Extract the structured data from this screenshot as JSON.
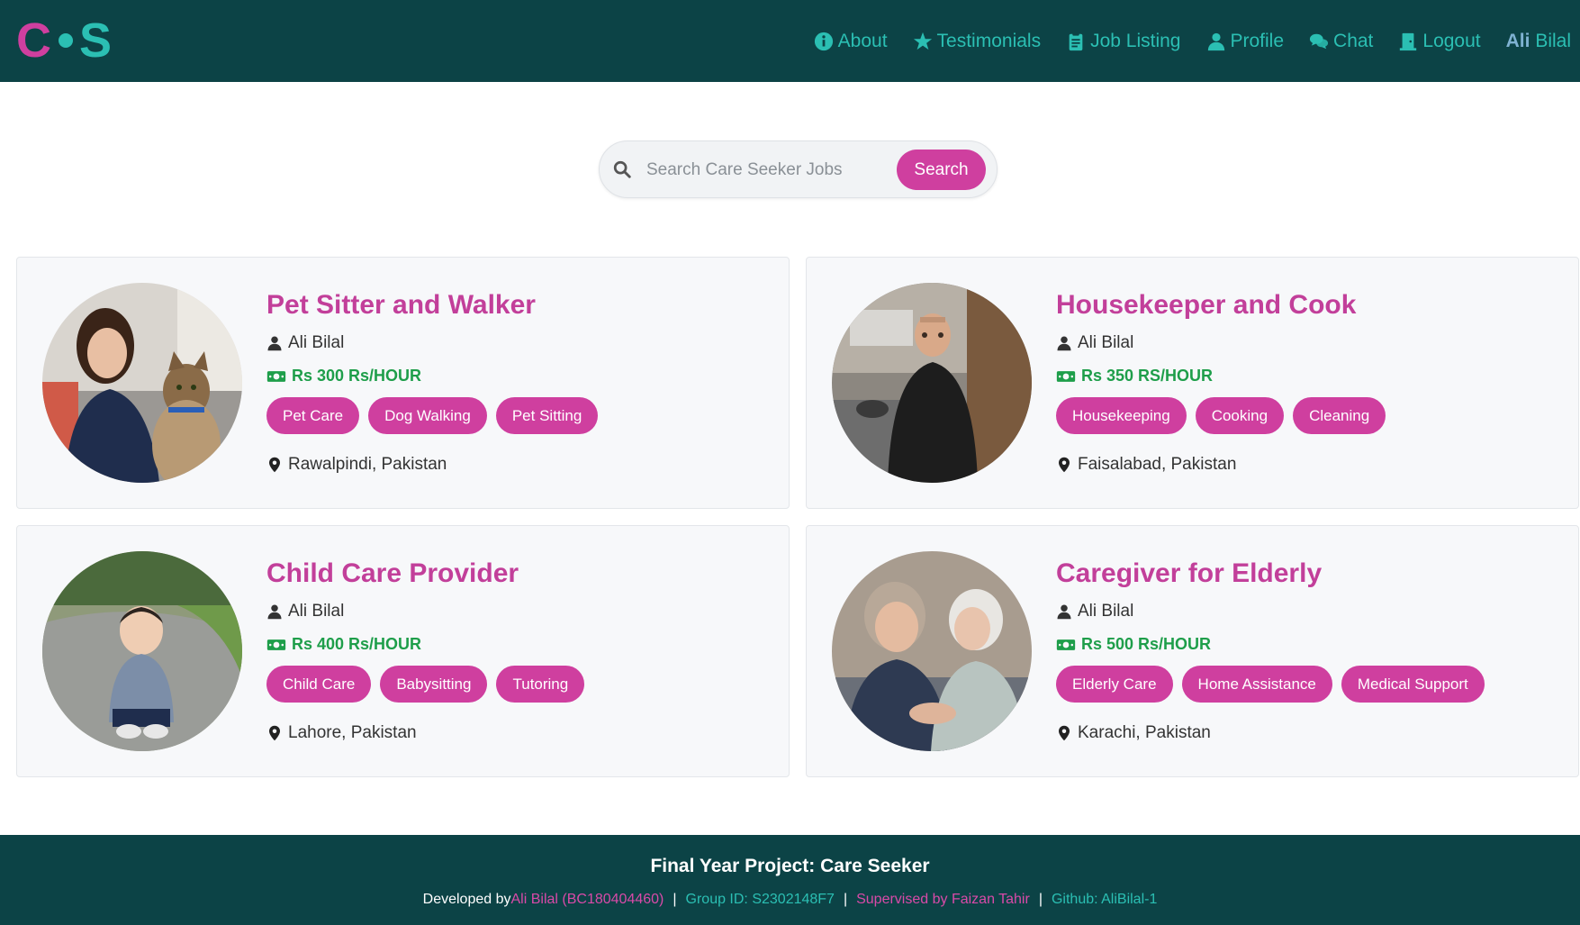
{
  "brand": {
    "logo_left": "C",
    "logo_right": "S"
  },
  "nav": {
    "items": [
      {
        "label": "About",
        "icon": "info-circle-icon"
      },
      {
        "label": "Testimonials",
        "icon": "star-icon"
      },
      {
        "label": "Job Listing",
        "icon": "clipboard-icon"
      },
      {
        "label": "Profile",
        "icon": "user-icon"
      },
      {
        "label": "Chat",
        "icon": "chat-bubbles-icon"
      },
      {
        "label": "Logout",
        "icon": "door-icon"
      }
    ],
    "user_first": "Ali",
    "user_last": "Bilal"
  },
  "search": {
    "placeholder": "Search Care Seeker Jobs",
    "value": "",
    "button_label": "Search"
  },
  "jobs": [
    {
      "title": "Pet Sitter and Walker",
      "owner": "Ali Bilal",
      "rate": "Rs 300 Rs/HOUR",
      "tags": [
        "Pet Care",
        "Dog Walking",
        "Pet Sitting"
      ],
      "location": "Rawalpindi, Pakistan"
    },
    {
      "title": "Housekeeper and Cook",
      "owner": "Ali Bilal",
      "rate": "Rs 350 RS/HOUR",
      "tags": [
        "Housekeeping",
        "Cooking",
        "Cleaning"
      ],
      "location": "Faisalabad, Pakistan"
    },
    {
      "title": "Child Care Provider",
      "owner": "Ali Bilal",
      "rate": "Rs 400 Rs/HOUR",
      "tags": [
        "Child Care",
        "Babysitting",
        "Tutoring"
      ],
      "location": "Lahore, Pakistan"
    },
    {
      "title": "Caregiver for Elderly",
      "owner": "Ali Bilal",
      "rate": "Rs 500 Rs/HOUR",
      "tags": [
        "Elderly Care",
        "Home Assistance",
        "Medical Support"
      ],
      "location": "Karachi, Pakistan"
    }
  ],
  "footer": {
    "title": "Final Year Project: Care Seeker",
    "developed_prefix": "Developed by ",
    "developer": "Ali Bilal (BC180404460)",
    "group": "Group ID: S2302148F7",
    "supervisor": "Supervised by Faizan Tahir",
    "github": "Github: AliBilal-1",
    "separator": "|"
  },
  "colors": {
    "navbar": "#0c4346",
    "accent_pink": "#cf3f9f",
    "accent_teal": "#2bbfb3",
    "rate_green": "#1e9e4a"
  }
}
